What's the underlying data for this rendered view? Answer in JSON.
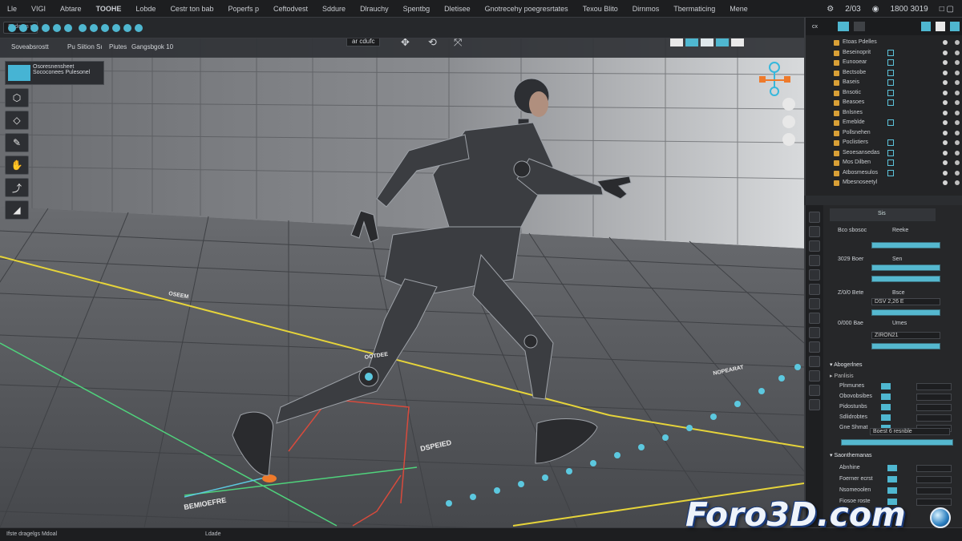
{
  "menu": {
    "items": [
      "Lle",
      "VIGI",
      "Abtare",
      "TOOHE",
      "Lobde",
      "Cestr ton bab",
      "Poperfs p",
      "Ceftodvest",
      "Sddure",
      "Dlrauchy",
      "Spentbg",
      "Dletisee",
      "Gnotrecehy poegresrtates",
      "Texou Blito",
      "Dirnmos",
      "Tbermaticing",
      "Mene"
    ],
    "right": [
      "2/03",
      "1800 3019"
    ]
  },
  "toolbar": {
    "dropdown_label": "Sedesm"
  },
  "viewport": {
    "title_left": "Soveabsrostt",
    "title_mid": "Pu Siition Sı",
    "title_mid2": "Piutes",
    "title_right": "Gangsbgok 10",
    "center_label": "ar cdufc",
    "tool_header": [
      "Osoresnensheet",
      "Sococonees Pulesonel"
    ],
    "tools": [
      "hexagon-outline",
      "diamond-outline",
      "brush",
      "hand",
      "curve",
      "spike"
    ],
    "nav_icons": [
      "lock-icon",
      "camera-icon",
      "globe-icon"
    ],
    "floor_labels": [
      "DSPEIED",
      "BEMIOEFRE",
      "OOTDEE",
      "NOPEARAT",
      "OSEEM"
    ]
  },
  "outliner": {
    "header_left": "cx",
    "rows": [
      {
        "name": "Etoas Pdelles",
        "teal": false
      },
      {
        "name": "Beseinoprit",
        "teal": true
      },
      {
        "name": "Eunooear",
        "teal": true
      },
      {
        "name": "Bectsobe",
        "teal": true
      },
      {
        "name": "Baseis",
        "teal": true
      },
      {
        "name": "Bnsotic",
        "teal": true
      },
      {
        "name": "Beasoes",
        "teal": true
      },
      {
        "name": "Bnlsnes",
        "teal": false
      },
      {
        "name": "Emeblde",
        "teal": true
      },
      {
        "name": "Pollsnehen",
        "teal": false
      },
      {
        "name": "Poclistiers",
        "teal": true
      },
      {
        "name": "Seoesansedas",
        "teal": true
      },
      {
        "name": "Mos Dilben",
        "teal": true
      },
      {
        "name": "Atbosmesulos",
        "teal": true
      },
      {
        "name": "Mbesnoseetyl",
        "teal": false
      }
    ]
  },
  "properties": {
    "tab_label": "Sis",
    "rows": [
      {
        "label": "Bco sbosoc",
        "value": "Reeke"
      },
      {
        "label": "3029 Boer",
        "value": "Sen"
      },
      {
        "label": "Z/0/0 Bete",
        "value": "Bsce",
        "field": "DSV 2,26 E"
      },
      {
        "label": "0/000 Bae",
        "value": "Umes",
        "field": "ZIRON21"
      }
    ],
    "section1": "Abogerlnes",
    "subsection1": "Panlisis",
    "section1_rows": [
      "Plnmunes",
      "Obovobsibes",
      "Pidostunbs",
      "Sdlidrobtes",
      "Gne Shmat"
    ],
    "section1_field": "Boest 6 resnble",
    "section2": "Saonthemanas",
    "section2_rows": [
      "Abnhine",
      "Foerner ecrst",
      "Nsomeoolen",
      "Fiosoe roste"
    ]
  },
  "statusbar": {
    "left": "Ifste dragelgs Mdoal",
    "mid": "Ldade"
  },
  "watermark": "Foro3D.com",
  "colors": {
    "accent": "#4fb7d0",
    "menubar_bg": "#1d1e20",
    "viewport_floor": "#4e5054",
    "yellow_guide": "#e6d43a",
    "green_guide": "#4fd37c",
    "red_guide": "#d94a3c",
    "orange": "#ee7a2b"
  }
}
